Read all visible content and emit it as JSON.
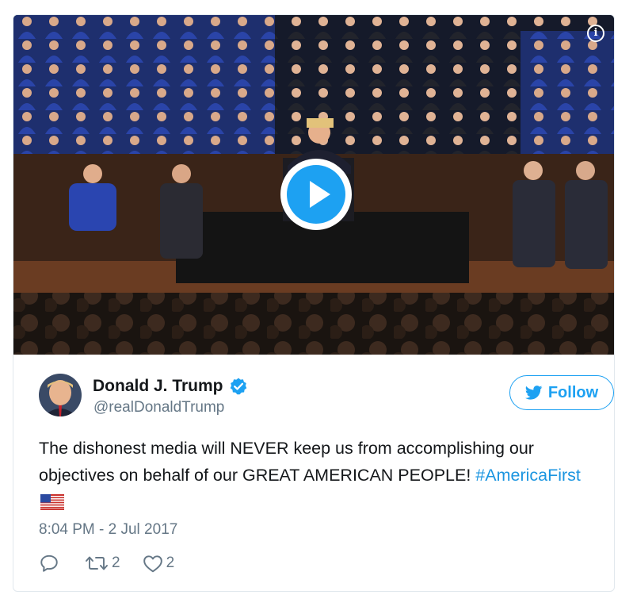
{
  "media": {
    "info_icon": "info-icon",
    "play_icon": "play-icon",
    "description_colors": {
      "accent": "#1da1f2"
    }
  },
  "author": {
    "display_name": "Donald J. Trump",
    "handle": "@realDonaldTrump",
    "verified": true,
    "verified_icon": "verified-badge-icon"
  },
  "follow": {
    "label": "Follow",
    "icon": "bird-icon"
  },
  "tweet": {
    "text": "The dishonest media will NEVER keep us from accomplishing our objectives on behalf of our GREAT AMERICAN PEOPLE! ",
    "hashtag": "#AmericaFirst",
    "emoji": "flag-us-icon",
    "timestamp": "8:04 PM - 2 Jul 2017"
  },
  "actions": {
    "reply_icon": "reply-icon",
    "retweet_icon": "retweet-icon",
    "retweet_count": "2",
    "like_icon": "heart-icon",
    "like_count": "2"
  },
  "colors": {
    "accent": "#1da1f2",
    "text": "#14171a",
    "secondary": "#657786",
    "border": "#e1e8ed"
  }
}
